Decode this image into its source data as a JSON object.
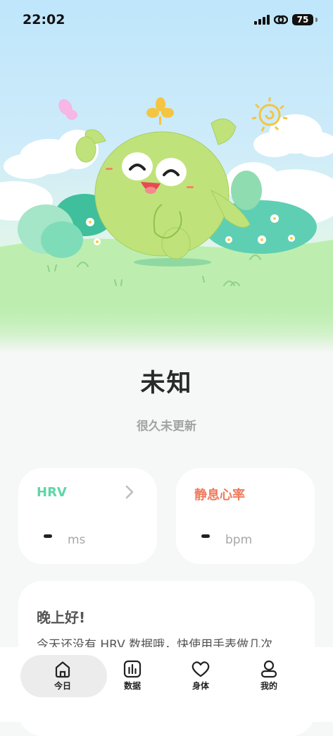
{
  "status_bar": {
    "time": "22:02",
    "battery": "75"
  },
  "main": {
    "title": "未知",
    "subtitle": "很久未更新"
  },
  "cards": {
    "hrv": {
      "label": "HRV",
      "value": "-",
      "unit": "ms"
    },
    "resting_hr": {
      "label": "静息心率",
      "value": "-",
      "unit": "bpm"
    }
  },
  "greeting": {
    "title": "晚上好!",
    "body": "今天还没有 HRV 数据哦，快使用手表做几次"
  },
  "tabs": [
    {
      "label": "今日",
      "icon": "home-icon",
      "active": true
    },
    {
      "label": "数据",
      "icon": "chart-icon",
      "active": false
    },
    {
      "label": "身体",
      "icon": "heart-icon",
      "active": false
    },
    {
      "label": "我的",
      "icon": "profile-icon",
      "active": false
    }
  ],
  "colors": {
    "hrv_label": "#5fd6a7",
    "heart_rate_label": "#ef7b5e",
    "mascot": "#bfe37a",
    "grass": "#bdeeb0"
  }
}
